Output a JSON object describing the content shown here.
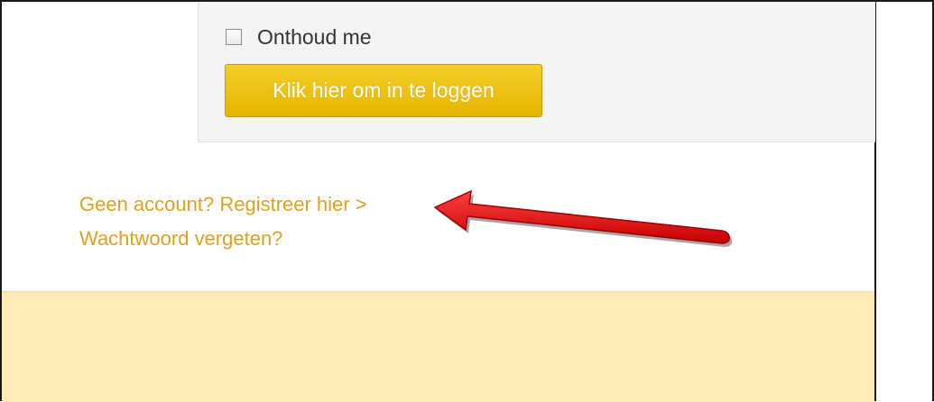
{
  "login": {
    "remember_label": "Onthoud me",
    "remember_checked": false,
    "submit_label": "Klik hier om in te loggen"
  },
  "links": {
    "register": "Geen account? Registreer hier >",
    "forgot_password": "Wachtwoord vergeten?"
  },
  "annotation": {
    "arrow_icon": "red-arrow-icon",
    "arrow_color": "#e8141a"
  },
  "colors": {
    "accent": "#e5b400",
    "link": "#e0a020",
    "panel": "#f4f4f4",
    "footer": "#ffeab8"
  }
}
